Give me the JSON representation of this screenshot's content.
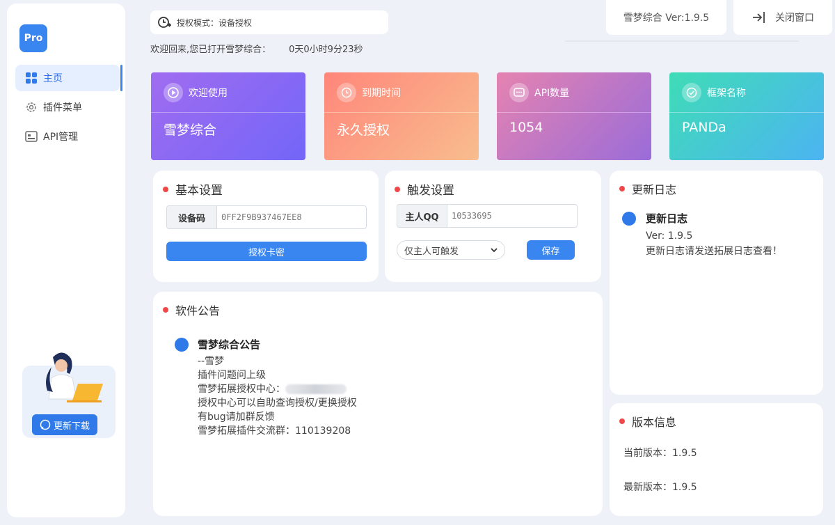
{
  "sidebar": {
    "logo": "Pro",
    "items": [
      {
        "label": "主页"
      },
      {
        "label": "插件菜单"
      },
      {
        "label": "API管理"
      }
    ],
    "promo_button": "更新下载"
  },
  "header": {
    "auth_mode": "授权模式：设备授权",
    "welcome_text": "欢迎回来,您已打开雪梦综合：",
    "uptime": "0天0小时9分23秒",
    "version_label": "雪梦综合 Ver:1.9.5",
    "close_label": "关闭窗口"
  },
  "stats": [
    {
      "label": "欢迎使用",
      "value": "雪梦综合",
      "icon": "play-circle-icon"
    },
    {
      "label": "到期时间",
      "value": "永久授权",
      "icon": "clock-icon"
    },
    {
      "label": "API数量",
      "value": "1054",
      "icon": "chat-icon"
    },
    {
      "label": "框架名称",
      "value": "PANDa",
      "icon": "check-circle-icon"
    }
  ],
  "basic_settings": {
    "title": "基本设置",
    "device_label": "设备码",
    "device_value": "0FF2F9B937467EE8",
    "button": "授权卡密"
  },
  "trigger_settings": {
    "title": "触发设置",
    "owner_label": "主人QQ",
    "owner_value": "10533695",
    "select_value": "仅主人可触发",
    "save_button": "保存"
  },
  "changelog": {
    "title": "更新日志",
    "entry_title": "更新日志",
    "entry_version": "Ver: 1.9.5",
    "entry_text": "更新日志请发送拓展日志查看！"
  },
  "announcement": {
    "title": "软件公告",
    "entry_title": "雪梦综合公告",
    "author": "--雪梦",
    "line1": "插件问题问上级",
    "line2": "雪梦拓展授权中心：",
    "line3": "授权中心可以自助查询授权/更换授权",
    "line4": "有bug请加群反馈",
    "line5": "雪梦拓展插件交流群：110139208"
  },
  "version_info": {
    "title": "版本信息",
    "current": "当前版本：1.9.5",
    "latest": "最新版本：1.9.5"
  },
  "colors": {
    "accent": "#3a86f0",
    "stat1": [
      "#9b6cf0",
      "#7b6cf5"
    ],
    "stat2": [
      "#ff8a7a",
      "#f7b88a"
    ],
    "stat3": [
      "#e07fb0",
      "#9a6ad8"
    ],
    "stat4": [
      "#3fd8b8",
      "#48b7f0"
    ]
  }
}
